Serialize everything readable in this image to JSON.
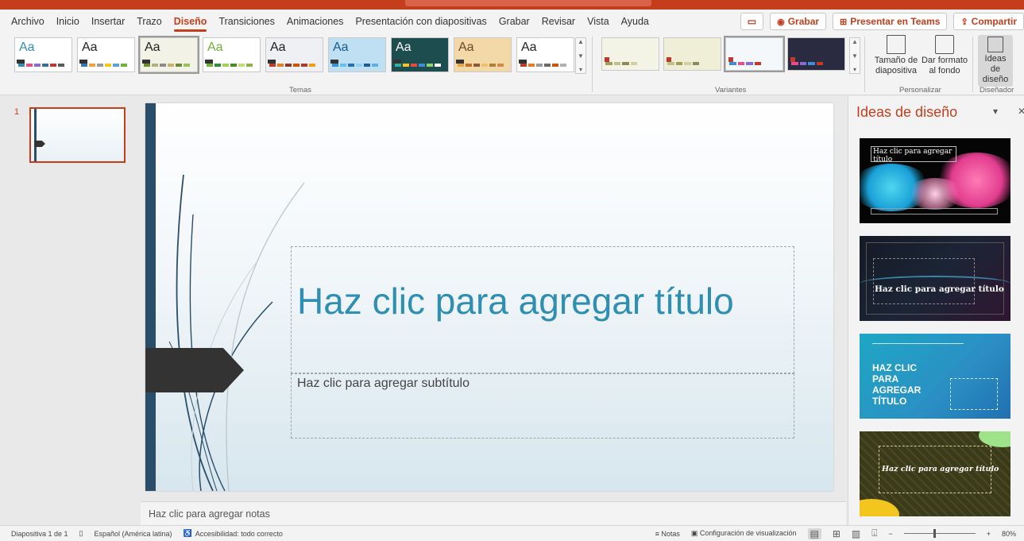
{
  "menu": {
    "tabs": [
      "Archivo",
      "Inicio",
      "Insertar",
      "Trazo",
      "Diseño",
      "Transiciones",
      "Animaciones",
      "Presentación con diapositivas",
      "Grabar",
      "Revisar",
      "Vista",
      "Ayuda"
    ],
    "active_tab": "Diseño",
    "record": "Grabar",
    "present_teams": "Presentar en Teams",
    "share": "Compartir"
  },
  "ribbon": {
    "themes_label": "Temas",
    "themes": [
      {
        "aa": "Aa",
        "aa_color": "#2f8fb3",
        "bars": [
          "#2f8fb3",
          "#e74c8c",
          "#8a6bd1",
          "#3a6e9a",
          "#c0392b",
          "#5b5b5b"
        ],
        "bg": "#ffffff"
      },
      {
        "aa": "Aa",
        "aa_color": "#222222",
        "bars": [
          "#3778c2",
          "#f0a23a",
          "#9a9a9a",
          "#f3c623",
          "#5aa0d6",
          "#6fb23a"
        ],
        "bg": "#ffffff"
      },
      {
        "aa": "Aa",
        "aa_color": "#222222",
        "bars": [
          "#6a8f2a",
          "#b1b47a",
          "#8a8a8a",
          "#c7b26e",
          "#6d8a3e",
          "#9ac056"
        ],
        "bg": "#f2f2e6"
      },
      {
        "aa": "Aa",
        "aa_color": "#6fb23a",
        "bars": [
          "#6fb23a",
          "#2f8f3a",
          "#a6cf5a",
          "#4c8c2a",
          "#c3dd7a",
          "#8ab24a"
        ],
        "bg": "#ffffff"
      },
      {
        "aa": "Aa",
        "aa_color": "#222222",
        "bars": [
          "#c0392b",
          "#e67e22",
          "#8e3b2b",
          "#d35400",
          "#b03a2e",
          "#f39c12"
        ],
        "bg": "#eef0f4"
      },
      {
        "aa": "Aa",
        "aa_color": "#1a5a8a",
        "bars": [
          "#3a8fd6",
          "#6ac1e8",
          "#2a6fb0",
          "#8fd3f0",
          "#1d5c94",
          "#5fb0e0"
        ],
        "bg": "#bfe0f3"
      },
      {
        "aa": "Aa",
        "aa_color": "#ffffff",
        "bars": [
          "#2fb0a0",
          "#f3c623",
          "#e74c3c",
          "#3a8fd6",
          "#8fd36a",
          "#ffffff"
        ],
        "bg": "#1e4d4f"
      },
      {
        "aa": "Aa",
        "aa_color": "#6a4a2a",
        "bars": [
          "#e0a84a",
          "#c0702a",
          "#8a5a3a",
          "#f0c06a",
          "#b08040",
          "#d08a4a"
        ],
        "bg": "#f3d9a8"
      },
      {
        "aa": "Aa",
        "aa_color": "#222222",
        "bars": [
          "#c0392b",
          "#e67e22",
          "#9a9a9a",
          "#6a6a6a",
          "#d35400",
          "#b0b0b0"
        ],
        "bg": "#ffffff"
      }
    ],
    "variants_label": "Variantes",
    "variants": [
      {
        "bg": "#f4f4e6",
        "bars": [
          "#a0a05a",
          "#c0c08a",
          "#8a8a5a",
          "#d0d0a0"
        ]
      },
      {
        "bg": "#efefd8",
        "bars": [
          "#c0c08a",
          "#a0a05a",
          "#d0d0a0",
          "#8a8a5a"
        ]
      },
      {
        "bg": "#f4f8fb",
        "bars": [
          "#3a8fd6",
          "#e74c8c",
          "#8a6bd1",
          "#c0392b"
        ]
      },
      {
        "bg": "#2a2a40",
        "bars": [
          "#e74c8c",
          "#8a6bd1",
          "#3a8fd6",
          "#c0392b"
        ]
      }
    ],
    "personalize_label": "Personalizar",
    "slide_size": "Tamaño de diapositiva",
    "format_bg": "Dar formato al fondo",
    "designer_label": "Diseñador",
    "design_ideas_btn": "Ideas de diseño"
  },
  "slides": {
    "number": "1"
  },
  "slide": {
    "title_placeholder": "Haz clic para agregar título",
    "subtitle_placeholder": "Haz clic para agregar subtítulo"
  },
  "notes_placeholder": "Haz clic para agregar notas",
  "design_pane": {
    "title": "Ideas de diseño",
    "idea1_title": "Haz clic para agregar título",
    "idea2_title": "Haz clic para agregar título",
    "idea3_title": "HAZ CLIC PARA AGREGAR TÍTULO",
    "idea4_title": "Haz clic para agregar título"
  },
  "status": {
    "slide_count": "Diapositiva 1 de 1",
    "language": "Español (América latina)",
    "accessibility": "Accesibilidad: todo correcto",
    "notes": "Notas",
    "view_settings": "Configuración de visualización",
    "zoom": "80%"
  },
  "colors": {
    "accent": "#c43e1c",
    "title_blue": "#2f8fb3",
    "slide_bar": "#2a4d69"
  }
}
